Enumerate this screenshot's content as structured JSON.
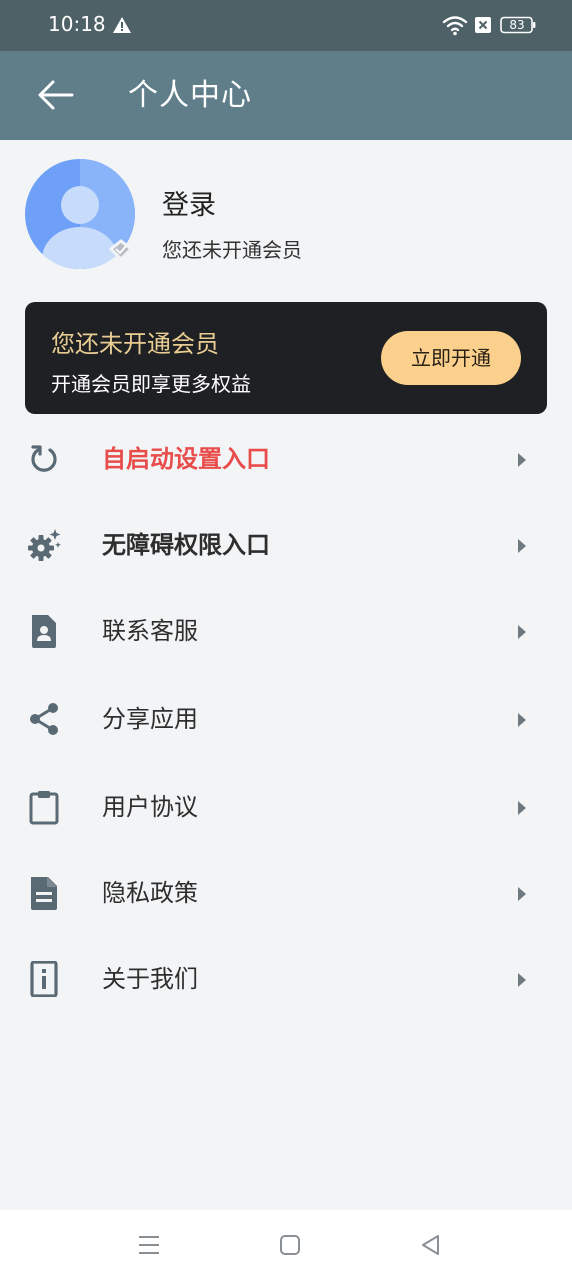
{
  "status_bar": {
    "time": "10:18",
    "battery": "83"
  },
  "app_bar": {
    "title": "个人中心"
  },
  "profile": {
    "login_label": "登录",
    "member_status": "您还未开通会员"
  },
  "vip_card": {
    "title": "您还未开通会员",
    "subtitle": "开通会员即享更多权益",
    "button_label": "立即开通"
  },
  "menu": {
    "items": [
      {
        "label": "自启动设置入口",
        "icon": "refresh-icon"
      },
      {
        "label": "无障碍权限入口",
        "icon": "settings-icon"
      },
      {
        "label": "联系客服",
        "icon": "contact-icon"
      },
      {
        "label": "分享应用",
        "icon": "share-icon"
      },
      {
        "label": "用户协议",
        "icon": "clipboard-icon"
      },
      {
        "label": "隐私政策",
        "icon": "document-icon"
      },
      {
        "label": "关于我们",
        "icon": "info-icon"
      }
    ]
  },
  "colors": {
    "app_bar": "#5f7e8a",
    "status_bar": "#4e6167",
    "accent_red": "#e84c4b",
    "vip_gold": "#e8cc92",
    "vip_button": "#fbd08c",
    "icon_gray": "#5a6a74"
  }
}
